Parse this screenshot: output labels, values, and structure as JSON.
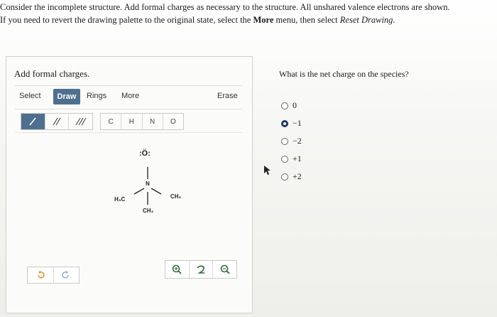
{
  "instructions": {
    "line1": "Consider the incomplete structure. Add formal charges as necessary to the structure. All unshared valence electrons are shown.",
    "line2_pre": "If you need to revert the drawing palette to the original state, select the ",
    "line2_more": "More",
    "line2_mid": " menu, then select ",
    "line2_reset": "Reset Drawing",
    "line2_end": "."
  },
  "editor": {
    "title": "Add formal charges.",
    "toolbar": {
      "select": "Select",
      "draw": "Draw",
      "rings": "Rings",
      "more": "More",
      "erase": "Erase"
    },
    "atoms": [
      "C",
      "H",
      "N",
      "O"
    ],
    "molecule": {
      "oxygen": ":Ö:",
      "nitrogen": "N",
      "left_group": "H₃C",
      "right_group": "CH₃",
      "bottom_group": "CH₃"
    }
  },
  "question": {
    "text": "What is the net charge on the species?",
    "options": [
      "0",
      "−1",
      "−2",
      "+1",
      "+2"
    ],
    "selected_index": 1
  },
  "colors": {
    "accent": "#4f6f8f",
    "radio_selected": "#1f3a5f",
    "zoom_icon": "#2e6b3a"
  }
}
